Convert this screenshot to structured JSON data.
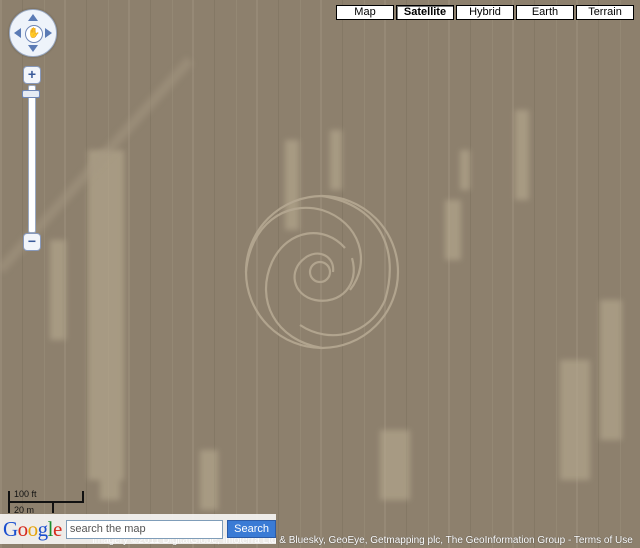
{
  "map_types": [
    {
      "label": "Map",
      "active": false
    },
    {
      "label": "Satellite",
      "active": true
    },
    {
      "label": "Hybrid",
      "active": false
    },
    {
      "label": "Earth",
      "active": false
    },
    {
      "label": "Terrain",
      "active": false
    }
  ],
  "zoom": {
    "in_label": "+",
    "out_label": "−"
  },
  "pan": {
    "center_icon": "hand-icon"
  },
  "scale": {
    "imperial": "100 ft",
    "metric": "20 m"
  },
  "search": {
    "placeholder": "search the map",
    "value": "search the map",
    "button_label": "Search"
  },
  "logo": {
    "text": "Google"
  },
  "footer": {
    "copyright": "Imagery ©2011 DigitalGlobe, Infoterra Ltd & Bluesky, GeoEye, Getmapping plc, The GeoInformation Group",
    "separator": " - ",
    "terms_label": "Terms of Use"
  },
  "colors": {
    "field": "#8d806d",
    "accent": "#3a7bd5"
  }
}
